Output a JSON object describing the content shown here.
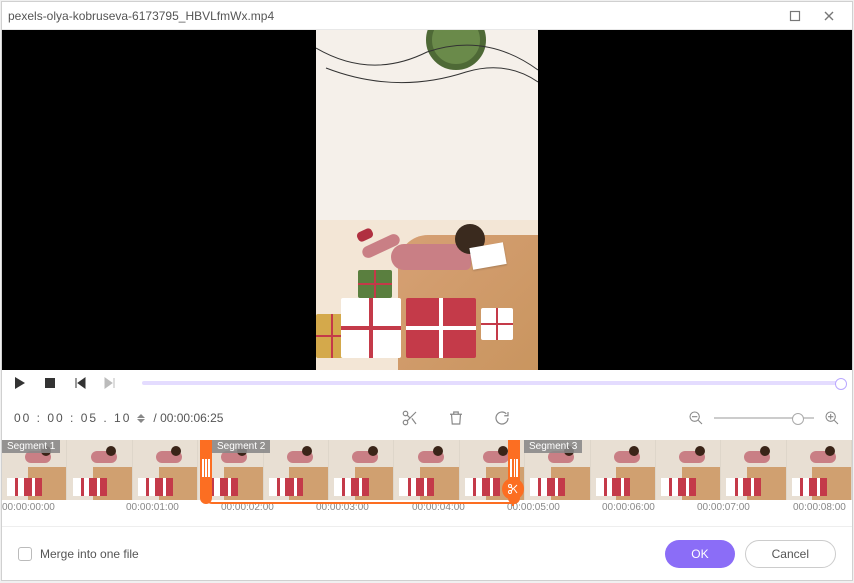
{
  "window": {
    "title": "pexels-olya-kobruseva-6173795_HBVLfmWx.mp4"
  },
  "playback": {
    "current_time": "00 : 00 : 05 . 10",
    "duration": "/ 00:00:06:25"
  },
  "segments": {
    "s1": "Segment 1",
    "s2": "Segment 2",
    "s3": "Segment 3"
  },
  "ticks": {
    "t0": "00:00:00:00",
    "t1": "00:00:01:00",
    "t2": "00:00:02:00",
    "t3": "00:00:03:00",
    "t4": "00:00:04:00",
    "t5": "00:00:05:00",
    "t6": "00:00:06:00",
    "t7": "00:00:07:00",
    "t8": "00:00:08:00"
  },
  "footer": {
    "merge_label": "Merge into one file",
    "ok": "OK",
    "cancel": "Cancel"
  }
}
